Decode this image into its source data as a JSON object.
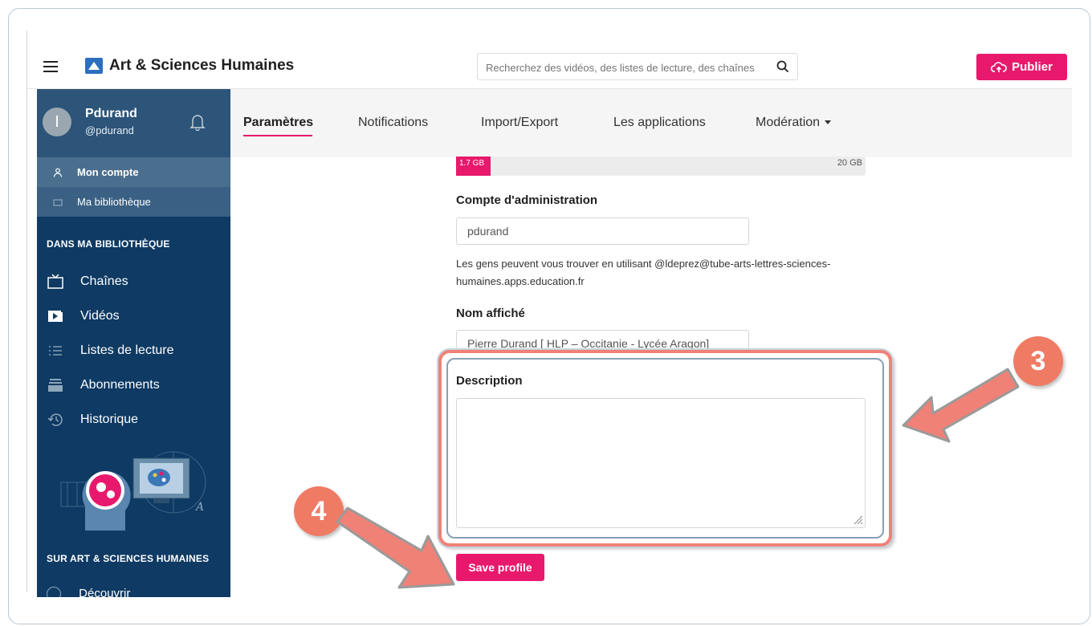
{
  "header": {
    "brand": "Art & Sciences Humaines",
    "search_placeholder": "Recherchez des vidéos, des listes de lecture, des chaînes",
    "publish_label": "Publier"
  },
  "user": {
    "initial": "I",
    "name": "Pdurand",
    "handle": "@pdurand"
  },
  "sidebar": {
    "account_items": [
      {
        "label": "Mon compte",
        "icon": "user-icon"
      },
      {
        "label": "Ma bibliothèque",
        "icon": "folder-icon"
      }
    ],
    "library_title": "DANS MA BIBLIOTHÈQUE",
    "library_items": [
      {
        "label": "Chaînes",
        "icon": "tv-icon"
      },
      {
        "label": "Vidéos",
        "icon": "video-icon"
      },
      {
        "label": "Listes de lecture",
        "icon": "list-icon"
      },
      {
        "label": "Abonnements",
        "icon": "inbox-icon"
      },
      {
        "label": "Historique",
        "icon": "history-icon"
      }
    ],
    "site_title": "SUR ART & SCIENCES HUMAINES",
    "site_items": [
      {
        "label": "Découvrir",
        "icon": "globe-icon"
      }
    ]
  },
  "tabs": [
    {
      "label": "Paramètres",
      "active": true
    },
    {
      "label": "Notifications"
    },
    {
      "label": "Import/Export"
    },
    {
      "label": "Les applications"
    },
    {
      "label": "Modération"
    }
  ],
  "quota": {
    "used": "1.7 GB",
    "max": "20 GB",
    "fraction": 0.085
  },
  "form": {
    "admin_label": "Compte d'administration",
    "admin_value": "pdurand",
    "help_text": "Les gens peuvent vous trouver en utilisant @ldeprez@tube-arts-lettres-sciences-humaines.apps.education.fr",
    "display_label": "Nom affiché",
    "display_value": "Pierre Durand [ HLP – Occitanie - Lycée Aragon]",
    "description_label": "Description",
    "description_value": "",
    "save_label": "Save profile"
  },
  "callouts": {
    "three": "3",
    "four": "4"
  },
  "colors": {
    "brand_pink": "#e8196c",
    "sidebar_bg": "#0e3a63",
    "callout": "#ef7b65"
  }
}
